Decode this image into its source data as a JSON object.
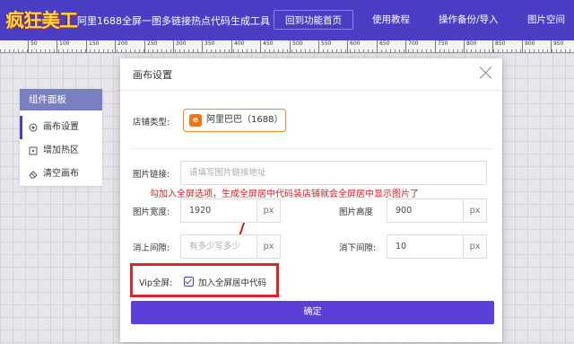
{
  "header": {
    "logo_text": "疯狂美工",
    "app_title": "阿里1688全屏一图多链接热点代码生成工具",
    "nav": [
      "回到功能首页",
      "使用教程",
      "操作备份/导入",
      "图片空间"
    ]
  },
  "ruler": {
    "ticks": [
      "50",
      "100",
      "150",
      "200",
      "250",
      "300",
      "350",
      "400",
      "450",
      "500",
      "550",
      "600",
      "650",
      "700",
      "750",
      "800",
      "850",
      "900",
      "950"
    ]
  },
  "panel": {
    "title": "组件面板",
    "items": [
      {
        "label": "画布设置",
        "icon": "target-icon"
      },
      {
        "label": "增加热区",
        "icon": "add-square-icon"
      },
      {
        "label": "清空画布",
        "icon": "eraser-icon"
      }
    ]
  },
  "modal": {
    "title": "画布设置",
    "shop_type_label": "店铺类型:",
    "shop_type_value": "阿里巴巴（1688）",
    "image_link_label": "图片链接:",
    "image_link_placeholder": "请填写图片链接地址",
    "width_label": "图片宽度:",
    "width_value": "1920",
    "height_label": "图片高度",
    "height_value": "900",
    "unit": "px",
    "margin_top_label": "消上间隙:",
    "margin_top_placeholder": "有多少写多少",
    "margin_bottom_label": "消下间隙:",
    "margin_bottom_value": "10",
    "vip_label": "Vip全屏:",
    "vip_checkbox_label": "加入全屏居中代码",
    "vip_checked": true,
    "confirm_label": "确定"
  },
  "annotation": {
    "text": "勾加入全屏选项，生成全屏居中代码装店铺就会全屏居中显示图片了",
    "color": "#d42020"
  },
  "colors": {
    "brand": "#4a3fc4",
    "confirm": "#5b3fd8",
    "highlight": "#e02424",
    "shop_border": "#ef8b2c"
  }
}
